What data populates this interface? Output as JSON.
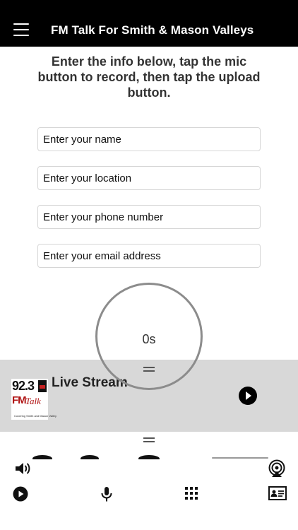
{
  "header": {
    "title": "FM Talk For Smith & Mason Valleys",
    "menu_icon": "hamburger-menu-icon"
  },
  "instructions": "Enter the info below, tap the mic button to record, then tap the upload button.",
  "form": {
    "name_placeholder": "Enter your name",
    "location_placeholder": "Enter your location",
    "phone_placeholder": "Enter your phone number",
    "email_placeholder": "Enter your email address"
  },
  "recorder": {
    "elapsed": "0s"
  },
  "player": {
    "title": "Live Stream",
    "logo": {
      "frequency": "92.3",
      "brand_fm": "FM",
      "brand_talk": "Talk",
      "tagline": "Covering Smith and Mason Valley"
    },
    "background": "#d8d8d8"
  },
  "bottom_bar": {
    "top_row": [
      "volume-icon",
      "airplay-icon"
    ],
    "tabs": [
      "play-icon",
      "microphone-icon",
      "grid-icon",
      "contact-card-icon"
    ]
  },
  "colors": {
    "header_bg": "#000000",
    "page_bg": "#ffffff",
    "brand_red": "#b01414"
  }
}
